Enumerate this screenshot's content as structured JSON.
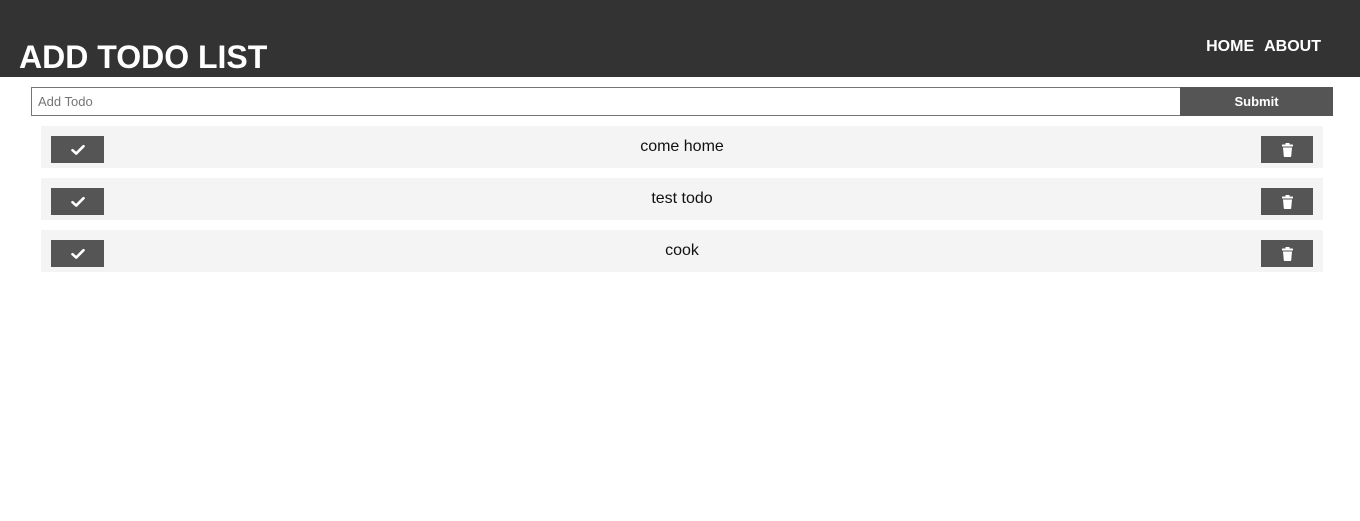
{
  "header": {
    "title": "ADD TODO LIST",
    "nav": [
      {
        "label": "HOME"
      },
      {
        "label": "ABOUT"
      }
    ]
  },
  "form": {
    "input_placeholder": "Add Todo",
    "input_value": "",
    "submit_label": "Submit"
  },
  "todos": [
    {
      "text": "come home",
      "complete_icon": "check-icon",
      "delete_icon": "trash-icon"
    },
    {
      "text": "test todo",
      "complete_icon": "check-icon",
      "delete_icon": "trash-icon"
    },
    {
      "text": "cook",
      "complete_icon": "check-icon",
      "delete_icon": "trash-icon"
    }
  ],
  "colors": {
    "header_bg": "#333333",
    "button_bg": "#555555",
    "item_bg": "#f4f4f4"
  }
}
